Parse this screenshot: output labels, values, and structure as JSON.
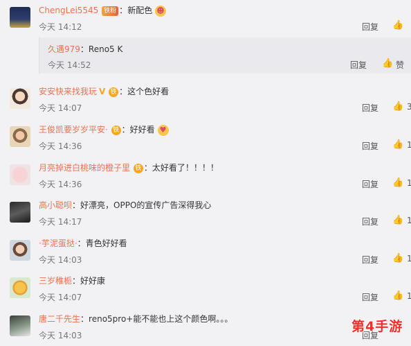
{
  "comments": [
    {
      "name": "ChengLei5545",
      "text": "新配色",
      "time": "今天 14:12",
      "reply": "回复",
      "likes": ""
    },
    {
      "name": "安安快来找我玩",
      "text": "这个色好看",
      "time": "今天 14:07",
      "reply": "回复",
      "likes": "3"
    },
    {
      "name": "王俊凯要岁岁平安·",
      "text": "好好看",
      "time": "今天 14:36",
      "reply": "回复",
      "likes": "1"
    },
    {
      "name": "月亮掉进白桃味的橙子里",
      "text": "太好看了！！！！",
      "time": "今天 14:36",
      "reply": "回复",
      "likes": "1"
    },
    {
      "name": "高小聪呗",
      "text": "好漂亮，OPPO的宣传广告深得我心",
      "time": "今天 14:17",
      "reply": "回复",
      "likes": "1"
    },
    {
      "name": "·芋泥蛋挞·",
      "text": "青色好好看",
      "time": "今天 14:03",
      "reply": "回复",
      "likes": "1"
    },
    {
      "name": "三岁稚栀",
      "text": "好好康",
      "time": "今天 14:07",
      "reply": "回复",
      "likes": "1"
    },
    {
      "name": "唐二千先生",
      "text": "reno5pro+能不能也上这个颜色啊。。。",
      "time": "今天 14:03",
      "reply": "回复",
      "likes": ""
    }
  ],
  "sub_reply": {
    "name": "久遇979",
    "text": "Reno5 K",
    "time": "今天 14:52",
    "reply": "回复",
    "like_label": "赞"
  },
  "colon": "：",
  "badge_text": "铁粉",
  "badge_round": "铁",
  "watermark": "第4手游",
  "colors": {
    "username": "#eb7350",
    "background": "#f2f2f5",
    "watermark": "#ff2b2b"
  },
  "icons": {
    "like": "thumbs-up-icon",
    "emoji": "smiley-emoji-icon"
  }
}
